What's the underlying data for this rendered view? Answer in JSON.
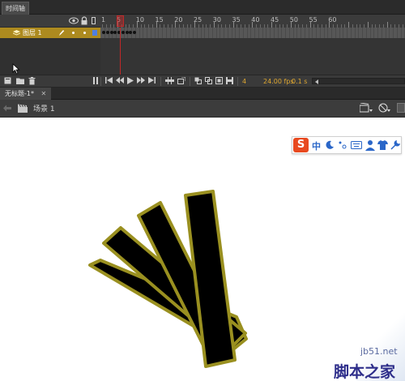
{
  "timeline": {
    "tab_label": "时间轴",
    "ruler_numbers": [
      "1",
      "5",
      "10",
      "15",
      "20",
      "25",
      "30",
      "35",
      "40",
      "45",
      "50",
      "55",
      "60"
    ],
    "layer_name": "图层 1",
    "current_frame": "4",
    "fps": "24.00 fps",
    "elapsed": "0.1 s"
  },
  "document": {
    "tab_label": "无标题-1*"
  },
  "scene": {
    "label": "场景 1"
  },
  "ime": {
    "logo_letter": "S",
    "mode_label": "中"
  },
  "watermark": {
    "site": "jb51.net",
    "brand": "脚本之家"
  },
  "colors": {
    "layer_highlight": "#ad8a1f",
    "playhead": "#c02828",
    "shape_fill": "#000000",
    "shape_stroke": "#9a9020",
    "ime_brand": "#e8491f"
  }
}
